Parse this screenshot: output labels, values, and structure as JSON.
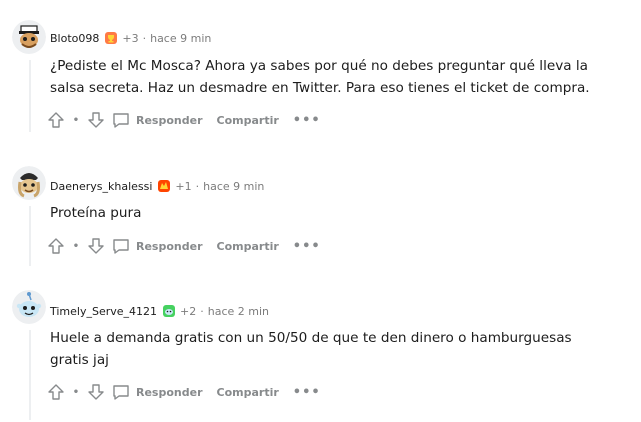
{
  "comments": [
    {
      "username": "Bloto098",
      "flair_icon": "trophy-flair-icon",
      "karma": "+3",
      "time": "hace 9 min",
      "text": "¿Pediste el Mc Mosca? Ahora ya sabes por qué no debes preguntar qué lleva la salsa secreta. Haz un desmadre en Twitter. Para eso tienes el ticket de compra.",
      "reply_label": "Responder",
      "share_label": "Compartir",
      "more_label": "•••"
    },
    {
      "username": "Daenerys_khalessi",
      "flair_icon": "dragon-flair-icon",
      "karma": "+1",
      "time": "hace 9 min",
      "text": "Proteína pura",
      "reply_label": "Responder",
      "share_label": "Compartir",
      "more_label": "•••"
    },
    {
      "username": "Timely_Serve_4121",
      "flair_icon": "snoo-flair-icon",
      "karma": "+2",
      "time": "hace 2 min",
      "text": "Huele a demanda gratis con un 50/50 de que te den dinero o hamburguesas gratis jaj",
      "reply_label": "Responder",
      "share_label": "Compartir",
      "more_label": "•••"
    }
  ],
  "colors": {
    "meta": "#7c7c7c",
    "action": "#878a8c",
    "thread_line": "#edeff1"
  }
}
